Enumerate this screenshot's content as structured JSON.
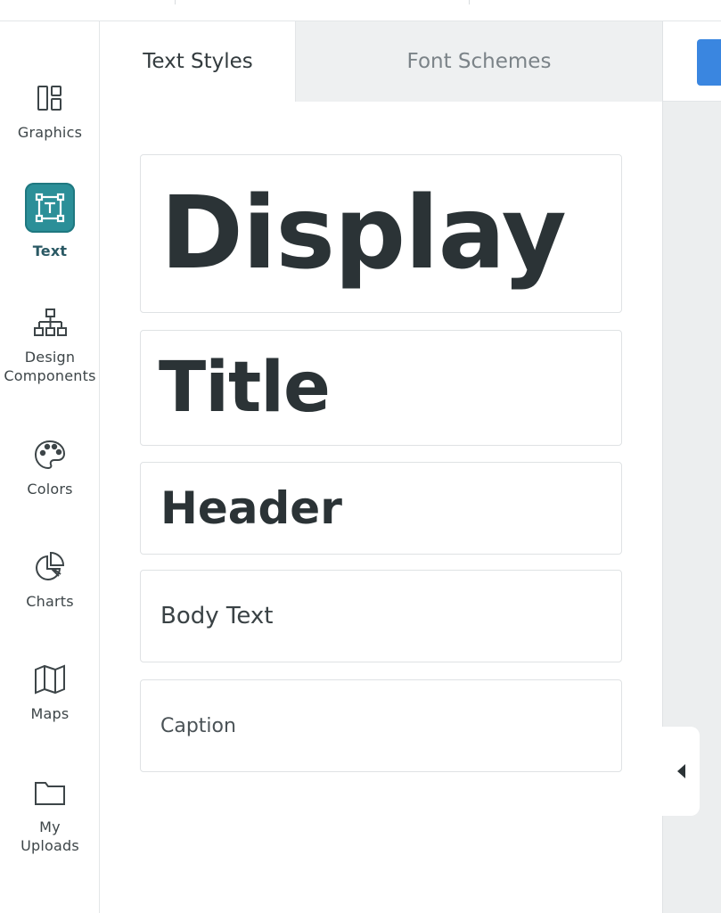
{
  "sidebar": {
    "items": [
      {
        "id": "graphics",
        "label": "Graphics",
        "icon": "graphics-icon"
      },
      {
        "id": "text",
        "label": "Text",
        "icon": "text-icon",
        "active": true
      },
      {
        "id": "design-components",
        "label": "Design\nComponents",
        "icon": "hierarchy-icon"
      },
      {
        "id": "colors",
        "label": "Colors",
        "icon": "palette-icon"
      },
      {
        "id": "charts",
        "label": "Charts",
        "icon": "pie-chart-icon"
      },
      {
        "id": "maps",
        "label": "Maps",
        "icon": "map-icon"
      },
      {
        "id": "my-uploads",
        "label": "My\nUploads",
        "icon": "folder-icon"
      }
    ]
  },
  "panel": {
    "tabs": [
      {
        "label": "Text Styles",
        "active": true
      },
      {
        "label": "Font Schemes",
        "active": false
      }
    ],
    "styles": [
      {
        "label": "Display"
      },
      {
        "label": "Title"
      },
      {
        "label": "Header"
      },
      {
        "label": "Body Text"
      },
      {
        "label": "Caption"
      }
    ]
  },
  "colors": {
    "accent": "#2b8f98",
    "text_dark": "#2b3336",
    "primary_button": "#3a86e0",
    "tab_inactive_bg": "#eef0f1"
  }
}
